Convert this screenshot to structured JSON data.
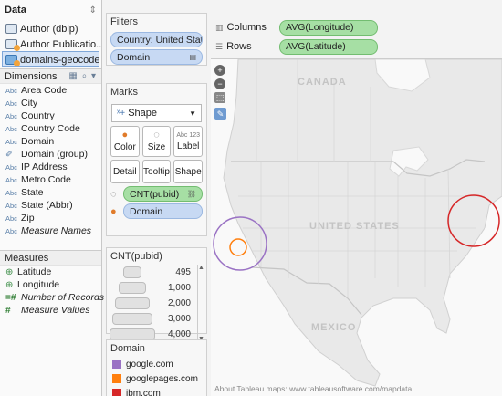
{
  "data_pane": {
    "title": "Data",
    "sources": [
      {
        "label": "Author (dblp)"
      },
      {
        "label": "Author Publicatio..."
      },
      {
        "label": "domains-geocoded"
      }
    ],
    "dimensions_title": "Dimensions",
    "dimensions": [
      {
        "type": "Abc",
        "label": "Area Code"
      },
      {
        "type": "Abc",
        "label": "City"
      },
      {
        "type": "Abc",
        "label": "Country"
      },
      {
        "type": "Abc",
        "label": "Country Code"
      },
      {
        "type": "Abc",
        "label": "Domain"
      },
      {
        "type": "✐",
        "label": "Domain (group)"
      },
      {
        "type": "Abc",
        "label": "IP Address"
      },
      {
        "type": "Abc",
        "label": "Metro Code"
      },
      {
        "type": "Abc",
        "label": "State"
      },
      {
        "type": "Abc",
        "label": "State (Abbr)"
      },
      {
        "type": "Abc",
        "label": "Zip"
      },
      {
        "type": "Abc",
        "label": "Measure Names"
      }
    ],
    "measures_title": "Measures",
    "measures": [
      {
        "type": "⊕",
        "label": "Latitude"
      },
      {
        "type": "⊕",
        "label": "Longitude"
      },
      {
        "type": "=#",
        "label": "Number of Records"
      },
      {
        "type": "#",
        "label": "Measure Values"
      }
    ]
  },
  "filters": {
    "title": "Filters",
    "items": [
      "Country: United States",
      "Domain"
    ]
  },
  "marks": {
    "title": "Marks",
    "mark_type": "Shape",
    "buttons": {
      "color": "Color",
      "size": "Size",
      "label": "Label",
      "detail": "Detail",
      "tooltip": "Tooltip",
      "shape": "Shape"
    },
    "size_icon_text": "Abc 123",
    "pills": [
      "CNT(pubid)",
      "Domain"
    ]
  },
  "size_legend": {
    "title": "CNT(pubid)",
    "values": [
      "495",
      "1,000",
      "2,000",
      "3,000",
      "4,000"
    ]
  },
  "color_legend": {
    "title": "Domain",
    "items": [
      {
        "label": "google.com",
        "color": "#9a72c4"
      },
      {
        "label": "googlepages.com",
        "color": "#ff7f0e"
      },
      {
        "label": "ibm.com",
        "color": "#d62728"
      }
    ]
  },
  "shelves": {
    "columns_label": "Columns",
    "columns_pill": "AVG(Longitude)",
    "rows_label": "Rows",
    "rows_pill": "AVG(Latitude)"
  },
  "map": {
    "labels": {
      "canada": "CANADA",
      "us": "UNITED STATES",
      "mexico": "MEXICO"
    },
    "attribution": "About Tableau maps: www.tableausoftware.com/mapdata",
    "colors": {
      "land": "#e9e9e9",
      "water": "#ffffff",
      "border": "#c9c9c9"
    }
  }
}
